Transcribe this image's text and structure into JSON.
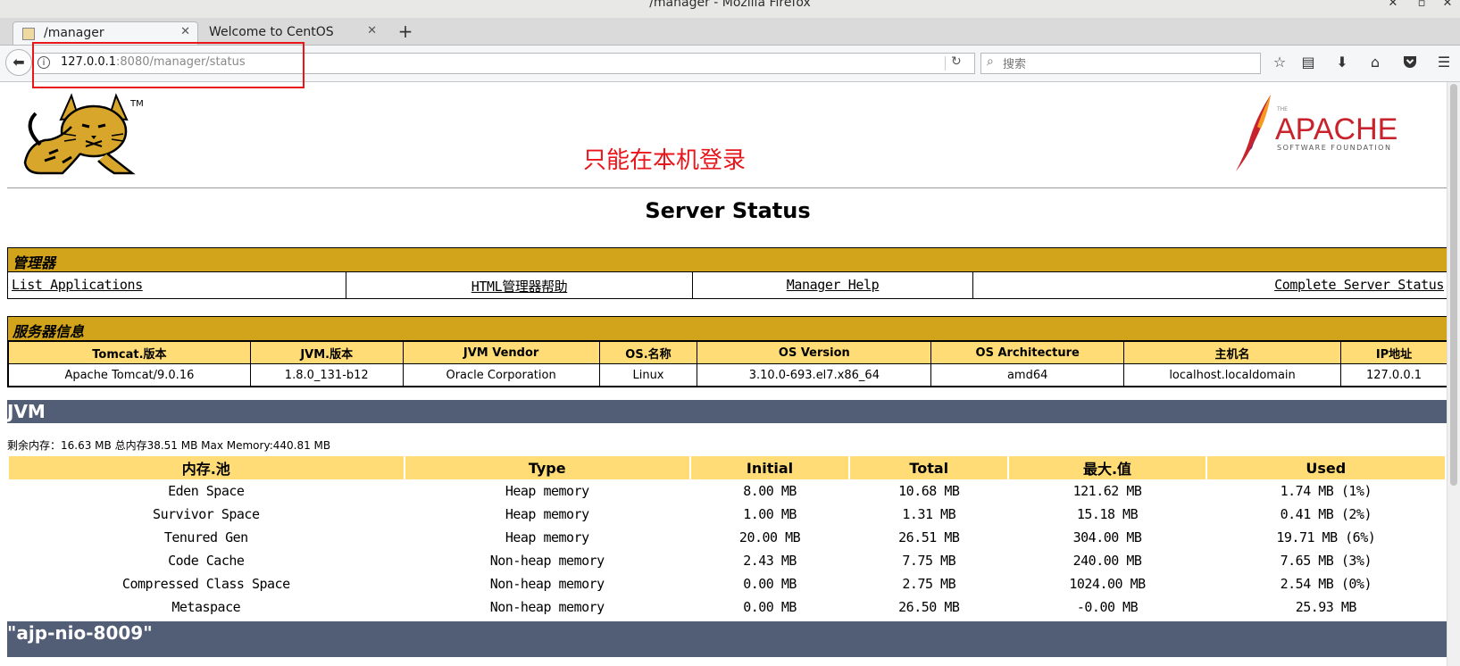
{
  "browser": {
    "window_title": "/manager - Mozilla Firefox",
    "tabs": [
      {
        "label": "/manager",
        "active": true
      },
      {
        "label": "Welcome to CentOS",
        "active": false
      }
    ],
    "url_host": "127.0.0.1",
    "url_rest": ":8080/manager/status",
    "search_placeholder": "搜索"
  },
  "page": {
    "login_note": "只能在本机登录",
    "title": "Server Status",
    "manager": {
      "heading": "管理器",
      "links": [
        "List Applications",
        "HTML管理器帮助",
        "Manager Help",
        "Complete Server Status"
      ]
    },
    "server_info": {
      "heading": "服务器信息",
      "headers": [
        "Tomcat.版本",
        "JVM.版本",
        "JVM Vendor",
        "OS.名称",
        "OS Version",
        "OS Architecture",
        "主机名",
        "IP地址"
      ],
      "values": [
        "Apache Tomcat/9.0.16",
        "1.8.0_131-b12",
        "Oracle Corporation",
        "Linux",
        "3.10.0-693.el7.x86_64",
        "amd64",
        "localhost.localdomain",
        "127.0.0.1"
      ]
    },
    "jvm": {
      "heading": "JVM",
      "memory_line": "剩余内存：16.63 MB 总内存38.51 MB Max Memory:440.81 MB",
      "pool_headers": [
        "内存.池",
        "Type",
        "Initial",
        "Total",
        "最大.值",
        "Used"
      ],
      "pools": [
        [
          "Eden Space",
          "Heap memory",
          "8.00 MB",
          "10.68 MB",
          "121.62 MB",
          "1.74 MB (1%)"
        ],
        [
          "Survivor Space",
          "Heap memory",
          "1.00 MB",
          "1.31 MB",
          "15.18 MB",
          "0.41 MB (2%)"
        ],
        [
          "Tenured Gen",
          "Heap memory",
          "20.00 MB",
          "26.51 MB",
          "304.00 MB",
          "19.71 MB (6%)"
        ],
        [
          "Code Cache",
          "Non-heap memory",
          "2.43 MB",
          "7.75 MB",
          "240.00 MB",
          "7.65 MB (3%)"
        ],
        [
          "Compressed Class Space",
          "Non-heap memory",
          "0.00 MB",
          "2.75 MB",
          "1024.00 MB",
          "2.54 MB (0%)"
        ],
        [
          "Metaspace",
          "Non-heap memory",
          "0.00 MB",
          "26.50 MB",
          "-0.00 MB",
          "25.93 MB"
        ]
      ]
    },
    "connector_heading": "\"ajp-nio-8009\""
  },
  "colors": {
    "box_header": "#d2a41c",
    "table_header": "#ffdc75",
    "section_bar": "#525d76",
    "annotation_red": "#e8161b"
  },
  "icons": [
    "back-icon",
    "info-icon",
    "reload-icon",
    "search-icon",
    "bookmark-star-icon",
    "reading-list-icon",
    "download-icon",
    "home-icon",
    "pocket-icon",
    "menu-icon",
    "tomcat-logo",
    "apache-logo"
  ]
}
